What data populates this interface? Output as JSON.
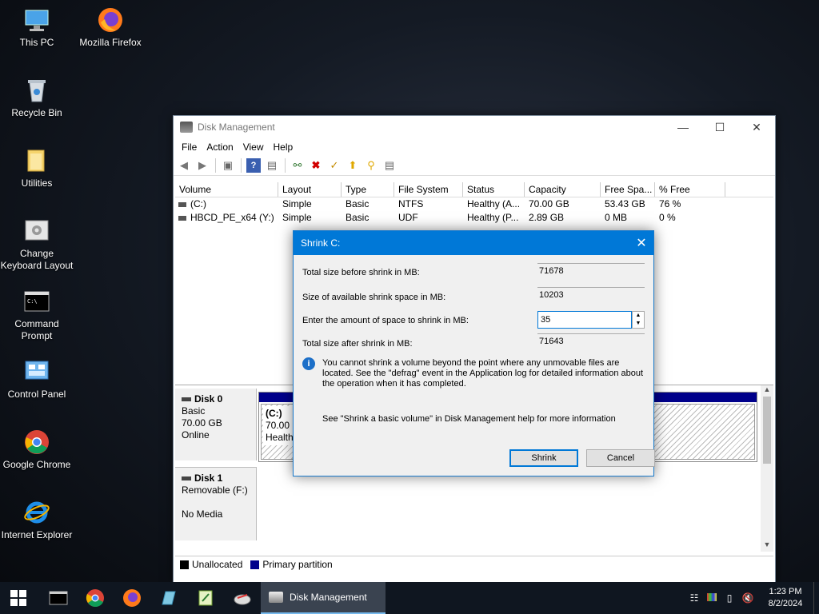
{
  "desktop": {
    "icons": [
      {
        "label": "This PC"
      },
      {
        "label": "Mozilla Firefox"
      },
      {
        "label": "Recycle Bin"
      },
      {
        "label": "Utilities"
      },
      {
        "label": "Change Keyboard Layout"
      },
      {
        "label": "Command Prompt"
      },
      {
        "label": "Control Panel"
      },
      {
        "label": "Google Chrome"
      },
      {
        "label": "Internet Explorer"
      }
    ]
  },
  "window": {
    "title": "Disk Management",
    "menu": [
      "File",
      "Action",
      "View",
      "Help"
    ],
    "columns": [
      "Volume",
      "Layout",
      "Type",
      "File System",
      "Status",
      "Capacity",
      "Free Spa...",
      "% Free"
    ],
    "volumes": [
      [
        "(C:)",
        "Simple",
        "Basic",
        "NTFS",
        "Healthy (A...",
        "70.00 GB",
        "53.43 GB",
        "76 %"
      ],
      [
        "HBCD_PE_x64 (Y:)",
        "Simple",
        "Basic",
        "UDF",
        "Healthy (P...",
        "2.89 GB",
        "0 MB",
        "0 %"
      ]
    ],
    "disk0": {
      "name": "Disk 0",
      "type": "Basic",
      "size": "70.00 GB",
      "state": "Online",
      "part_name": "(C:)",
      "part_size": "70.00 G",
      "part_status": "Health"
    },
    "disk1": {
      "name": "Disk 1",
      "type": "Removable (F:)",
      "state": "No Media"
    },
    "legend": {
      "unallocated": "Unallocated",
      "primary": "Primary partition",
      "unallocated_color": "#000000",
      "primary_color": "#00008b"
    }
  },
  "dialog": {
    "title": "Shrink C:",
    "total_before_label": "Total size before shrink in MB:",
    "total_before_value": "71678",
    "available_label": "Size of available shrink space in MB:",
    "available_value": "10203",
    "enter_label": "Enter the amount of space to shrink in MB:",
    "enter_value": "35",
    "after_label": "Total size after shrink in MB:",
    "after_value": "71643",
    "info_text": "You cannot shrink a volume beyond the point where any unmovable files are located. See the \"defrag\" event in the Application log for detailed information about the operation when it has completed.",
    "help_text": "See \"Shrink a basic volume\" in Disk Management help for more information",
    "shrink_button": "Shrink",
    "cancel_button": "Cancel"
  },
  "taskbar": {
    "active_app": "Disk Management",
    "time": "1:23 PM",
    "date": "8/2/2024"
  },
  "colors": {
    "accent": "#0078d7",
    "taskbar": "#0f1620"
  }
}
